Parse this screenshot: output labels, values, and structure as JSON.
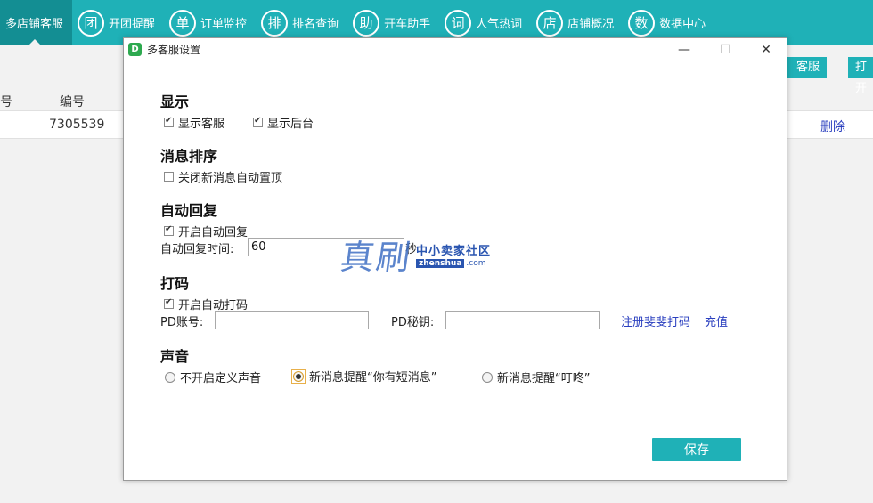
{
  "nav": {
    "items": [
      {
        "icon": "",
        "label": "多店铺客服",
        "active": true
      },
      {
        "icon": "团",
        "label": "开团提醒"
      },
      {
        "icon": "单",
        "label": "订单监控"
      },
      {
        "icon": "排",
        "label": "排名查询"
      },
      {
        "icon": "助",
        "label": "开车助手"
      },
      {
        "icon": "词",
        "label": "人气热词"
      },
      {
        "icon": "店",
        "label": "店铺概况"
      },
      {
        "icon": "数",
        "label": "数据中心"
      }
    ]
  },
  "background": {
    "btn_kefu": "客服",
    "btn_open": "打开",
    "col_hao": "号",
    "col_bianhao": "编号",
    "row_bianhao": "7305539",
    "row_delete": "删除"
  },
  "dialog": {
    "title": "多客服设置",
    "minimize": "—",
    "maximize": "☐",
    "close": "✕",
    "display": {
      "title": "显示",
      "show_kefu": {
        "label": "显示客服",
        "checked": true
      },
      "show_backend": {
        "label": "显示后台",
        "checked": true
      }
    },
    "msg_sort": {
      "title": "消息排序",
      "disable_pin": {
        "label": "关闭新消息自动置顶",
        "checked": false
      }
    },
    "auto_reply": {
      "title": "自动回复",
      "enable": {
        "label": "开启自动回复",
        "checked": true
      },
      "time_label": "自动回复时间:",
      "time_value": "60",
      "time_unit": "秒"
    },
    "captcha": {
      "title": "打码",
      "enable": {
        "label": "开启自动打码",
        "checked": true
      },
      "pd_account_label": "PD账号:",
      "pd_account_value": "",
      "pd_secret_label": "PD秘钥:",
      "pd_secret_value": "",
      "register_link": "注册斐斐打码",
      "recharge_link": "充值"
    },
    "sound": {
      "title": "声音",
      "options": [
        {
          "label": "不开启定义声音",
          "checked": false
        },
        {
          "label": "新消息提醒“你有短消息”",
          "checked": true
        },
        {
          "label": "新消息提醒“叮咚”",
          "checked": false
        }
      ]
    },
    "save": "保存"
  },
  "watermark": {
    "big": "真刷",
    "cn": "中小卖家社区",
    "en": "zhenshua",
    "domain": ".com"
  }
}
